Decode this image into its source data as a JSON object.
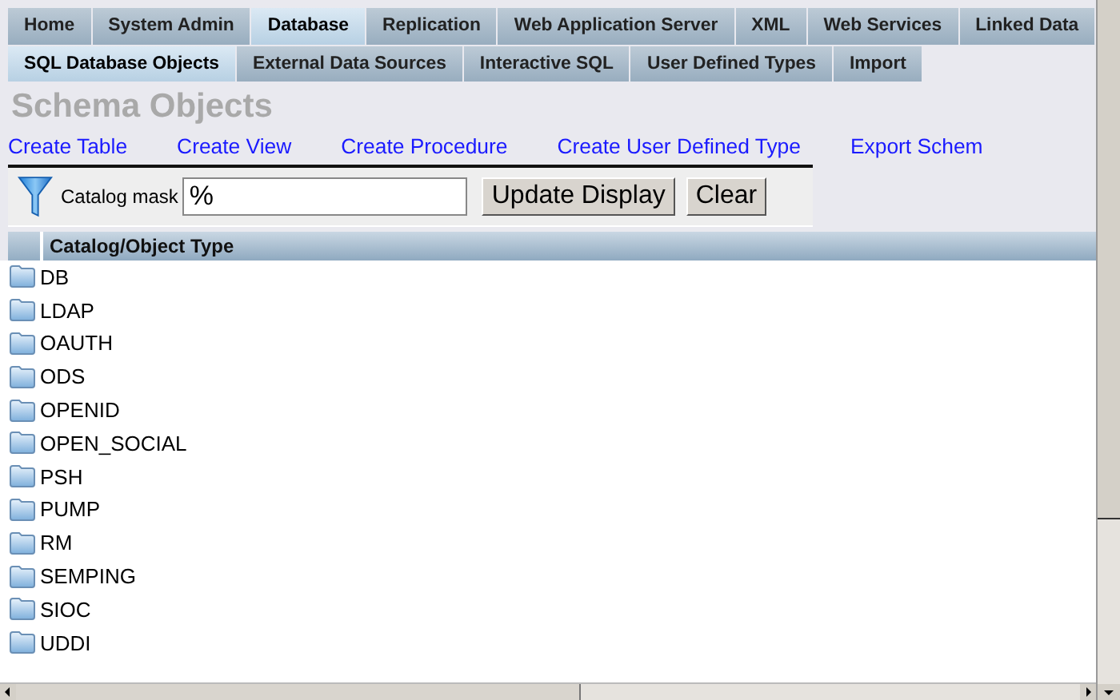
{
  "main_tabs": [
    {
      "label": "Home",
      "selected": false
    },
    {
      "label": "System Admin",
      "selected": false
    },
    {
      "label": "Database",
      "selected": true
    },
    {
      "label": "Replication",
      "selected": false
    },
    {
      "label": "Web Application Server",
      "selected": false
    },
    {
      "label": "XML",
      "selected": false
    },
    {
      "label": "Web Services",
      "selected": false
    },
    {
      "label": "Linked Data",
      "selected": false
    }
  ],
  "sub_tabs": [
    {
      "label": "SQL Database Objects",
      "selected": true
    },
    {
      "label": "External Data Sources",
      "selected": false
    },
    {
      "label": "Interactive SQL",
      "selected": false
    },
    {
      "label": "User Defined Types",
      "selected": false
    },
    {
      "label": "Import",
      "selected": false
    }
  ],
  "page_title": "Schema Objects",
  "actions": [
    "Create Table",
    "Create View",
    "Create Procedure",
    "Create User Defined Type",
    "Export Schem"
  ],
  "filter": {
    "label": "Catalog mask",
    "value": "%",
    "buttons": [
      "Update Display",
      "Clear"
    ]
  },
  "table": {
    "column": "Catalog/Object Type",
    "rows": [
      "DB",
      "LDAP",
      "OAUTH",
      "ODS",
      "OPENID",
      "OPEN_SOCIAL",
      "PSH",
      "PUMP",
      "RM",
      "SEMPING",
      "SIOC",
      "UDDI"
    ]
  }
}
